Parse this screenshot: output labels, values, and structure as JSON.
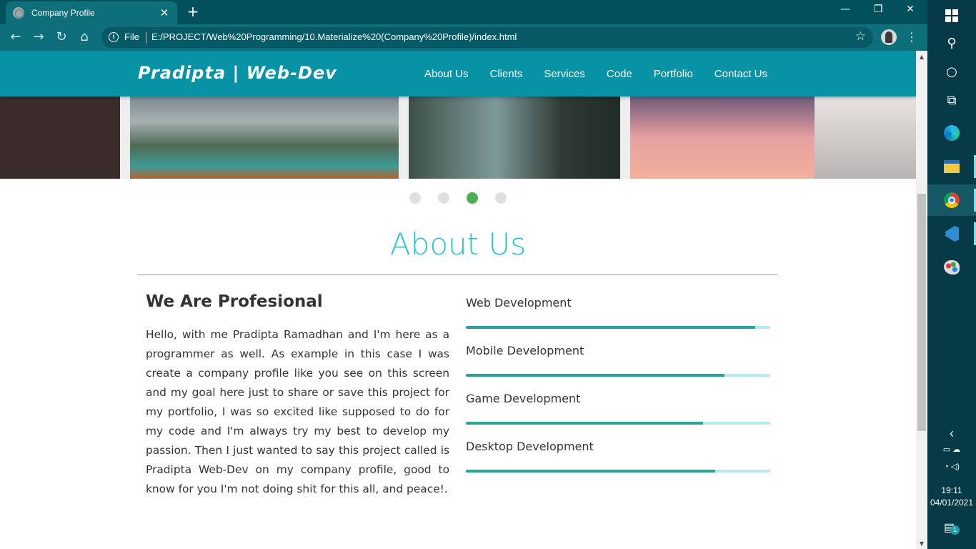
{
  "browser": {
    "tab_title": "Company Profile",
    "tab_close": "✕",
    "new_tab": "+",
    "window_controls": {
      "minimize": "—",
      "restore": "❐",
      "close": "✕"
    },
    "nav": {
      "back": "←",
      "forward": "→",
      "reload": "↻",
      "home": "⌂"
    },
    "info_icon": "i",
    "scheme_label": "File",
    "url": "E:/PROJECT/Web%20Programming/10.Materialize%20(Company%20Profile)/index.html",
    "bookmark_star": "☆",
    "menu": "⋮"
  },
  "site": {
    "brand": "Pradipta | Web-Dev",
    "nav_links": [
      "About Us",
      "Clients",
      "Services",
      "Code",
      "Portfolio",
      "Contact Us"
    ],
    "carousel": {
      "slide_count": 4,
      "active_index": 2
    }
  },
  "about": {
    "title": "About Us",
    "subtitle": "We Are Profesional",
    "body": "Hello, with me Pradipta Ramadhan and I'm here as a programmer as well. As example in this case I was create a company profile like you see on this screen and my goal here just to share or save this project for my portfolio, I was so excited like supposed to do for my code and I'm always try my best to develop my passion. Then I just wanted to say this project called is Pradipta Web-Dev on my company profile, good to know for you I'm not doing shit for this all, and peace!.",
    "skills": [
      {
        "name": "Web Development",
        "progress": 0.95
      },
      {
        "name": "Mobile Development",
        "progress": 0.85
      },
      {
        "name": "Game Development",
        "progress": 0.78
      },
      {
        "name": "Desktop Development",
        "progress": 0.82
      }
    ]
  },
  "colors": {
    "nav_bg": "#0892a5",
    "title": "#26c6da",
    "progress_fill": "#26a69a",
    "progress_track": "#b2ebf2",
    "dot_active": "#4caf50"
  },
  "taskbar": {
    "start_icon": "windows-logo-icon",
    "search_icon": "⚲",
    "cortana_icon": "○",
    "taskview_icon": "⧉",
    "apps": [
      "edge-icon",
      "file-explorer-icon",
      "chrome-icon",
      "vscode-icon",
      "paint-icon"
    ],
    "tray_chevron": "‹",
    "time": "19:11",
    "date": "04/01/2021",
    "notification_count": "1"
  }
}
